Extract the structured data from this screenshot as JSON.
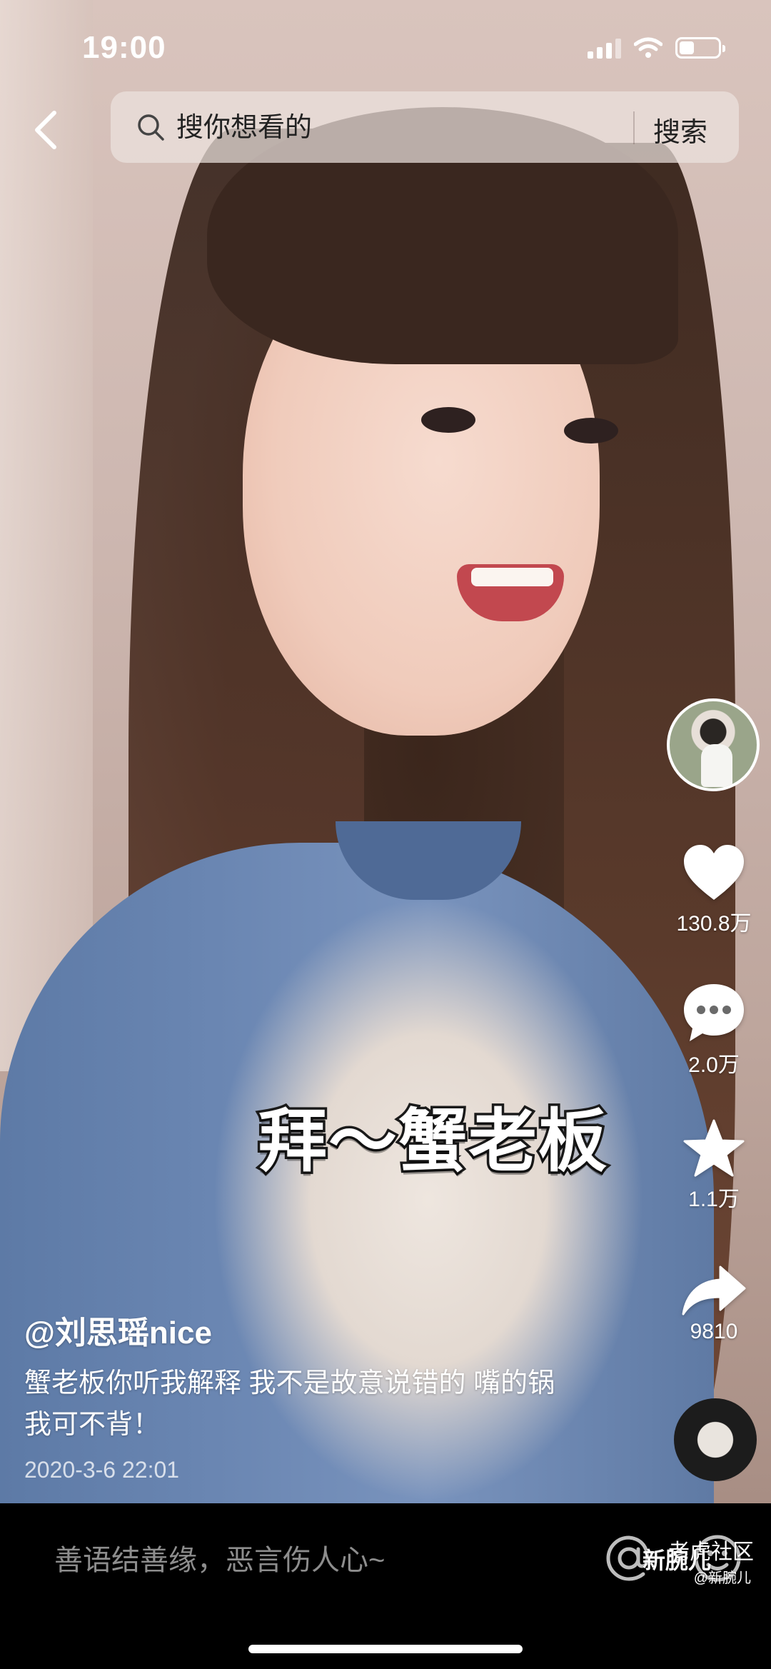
{
  "status_bar": {
    "time": "19:00"
  },
  "search": {
    "placeholder": "搜你想看的",
    "button_label": "搜索"
  },
  "video": {
    "caption_overlay": "拜～蟹老板"
  },
  "actions": {
    "like_count": "130.8万",
    "comment_count": "2.0万",
    "favorite_count": "1.1万",
    "share_count": "9810"
  },
  "post": {
    "author": "@刘思瑶nice",
    "description": "蟹老板你听我解释 我不是故意说错的 嘴的锅我可不背！",
    "date": "2020-3-6 22:01"
  },
  "comment_bar": {
    "placeholder": "善语结善缘，恶言伤人心~"
  },
  "watermark": {
    "line1": "老虎社区",
    "line2": "新腕儿",
    "line3": "@新腕儿"
  }
}
